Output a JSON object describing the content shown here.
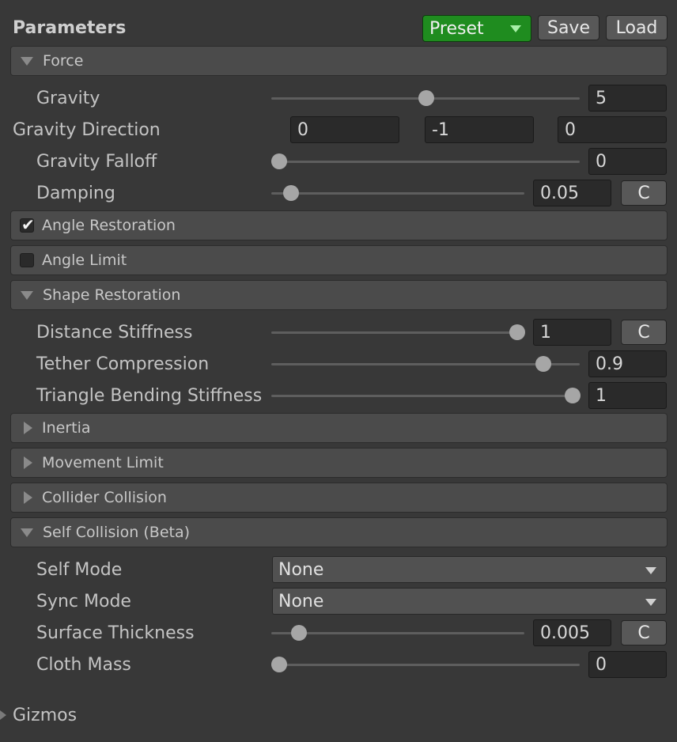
{
  "header": {
    "title": "Parameters",
    "preset_label": "Preset",
    "save_label": "Save",
    "load_label": "Load"
  },
  "sections": {
    "force": "Force",
    "angle_restoration": "Angle Restoration",
    "angle_limit": "Angle Limit",
    "shape_restoration": "Shape Restoration",
    "inertia": "Inertia",
    "movement_limit": "Movement Limit",
    "collider_collision": "Collider Collision",
    "self_collision": "Self Collision (Beta)"
  },
  "section_state": {
    "angle_restoration_checked": true,
    "angle_limit_checked": false
  },
  "force": {
    "gravity": {
      "label": "Gravity",
      "value": "5",
      "slider_fraction": 0.5
    },
    "gravity_direction": {
      "label": "Gravity Direction",
      "x": "0",
      "y": "-1",
      "z": "0"
    },
    "gravity_falloff": {
      "label": "Gravity Falloff",
      "value": "0",
      "slider_fraction": 0.0
    },
    "damping": {
      "label": "Damping",
      "value": "0.05",
      "slider_fraction": 0.05,
      "curve_button": "C"
    }
  },
  "shape": {
    "distance_stiffness": {
      "label": "Distance Stiffness",
      "value": "1",
      "slider_fraction": 1.0,
      "curve_button": "C"
    },
    "tether_compression": {
      "label": "Tether Compression",
      "value": "0.9",
      "slider_fraction": 0.9
    },
    "triangle_bending": {
      "label": "Triangle Bending Stiffness",
      "value": "1",
      "slider_fraction": 1.0
    }
  },
  "self_collision": {
    "self_mode": {
      "label": "Self Mode",
      "value": "None"
    },
    "sync_mode": {
      "label": "Sync Mode",
      "value": "None"
    },
    "surface_thickness": {
      "label": "Surface Thickness",
      "value": "0.005",
      "slider_fraction": 0.1,
      "curve_button": "C"
    },
    "cloth_mass": {
      "label": "Cloth Mass",
      "value": "0",
      "slider_fraction": 0.0
    }
  },
  "footer": {
    "gizmos": "Gizmos"
  }
}
